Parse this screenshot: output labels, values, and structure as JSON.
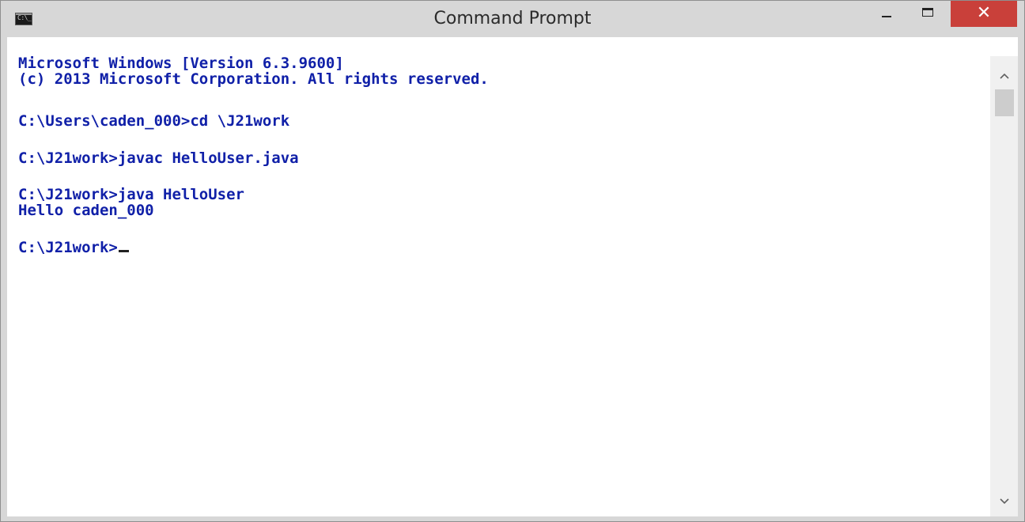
{
  "window": {
    "title": "Command Prompt",
    "icon": "cmd-icon",
    "icon_glyph": "C:\\_",
    "controls": {
      "minimize_icon": "minimize-icon",
      "maximize_icon": "maximize-icon",
      "close_icon": "close-icon",
      "close_glyph": "✕",
      "close_color": "#c9403a"
    }
  },
  "console": {
    "text_color": "#1020a8",
    "background": "#ffffff",
    "lines": [
      "Microsoft Windows [Version 6.3.9600]",
      "(c) 2013 Microsoft Corporation. All rights reserved.",
      "C:\\Users\\caden_000>cd \\J21work",
      "C:\\J21work>javac HelloUser.java",
      "C:\\J21work>java HelloUser",
      "Hello caden_000",
      "C:\\J21work>"
    ]
  },
  "scrollbar": {
    "up_glyph": "^",
    "down_glyph": "v",
    "up_icon": "chevron-up-icon",
    "down_icon": "chevron-down-icon"
  }
}
